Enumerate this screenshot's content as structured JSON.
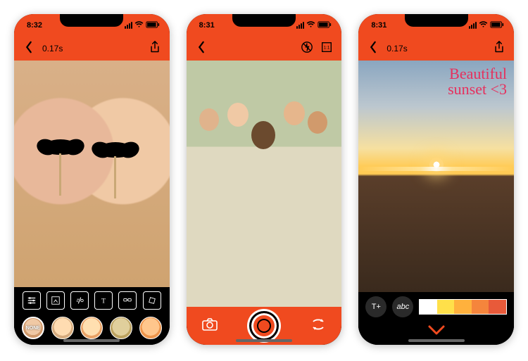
{
  "screens": {
    "editor": {
      "time": "8:32",
      "title": "0.17s",
      "tools": [
        "adjust-icon",
        "transform-icon",
        "speed-icon",
        "text-icon",
        "sticker-icon",
        "rotate-icon"
      ],
      "filters": [
        {
          "label": "NONE",
          "selected": true
        },
        {
          "label": ""
        },
        {
          "label": ""
        },
        {
          "label": ""
        },
        {
          "label": ""
        }
      ]
    },
    "camera": {
      "time": "8:31",
      "top_icons": [
        "flash-off-icon",
        "aspect-ratio-icon"
      ],
      "controls": [
        "gallery-icon",
        "shutter-button",
        "switch-camera-icon"
      ]
    },
    "annotate": {
      "time": "8:31",
      "title": "0.17s",
      "overlay_line1": "Beautiful",
      "overlay_line2": "sunset <3",
      "edit_buttons": [
        "T+",
        "abc"
      ],
      "palette": [
        "#ffffff",
        "#ffe04a",
        "#ffb13d",
        "#f5853c",
        "#e85a3a"
      ]
    }
  },
  "colors": {
    "accent": "#f04a1f"
  }
}
